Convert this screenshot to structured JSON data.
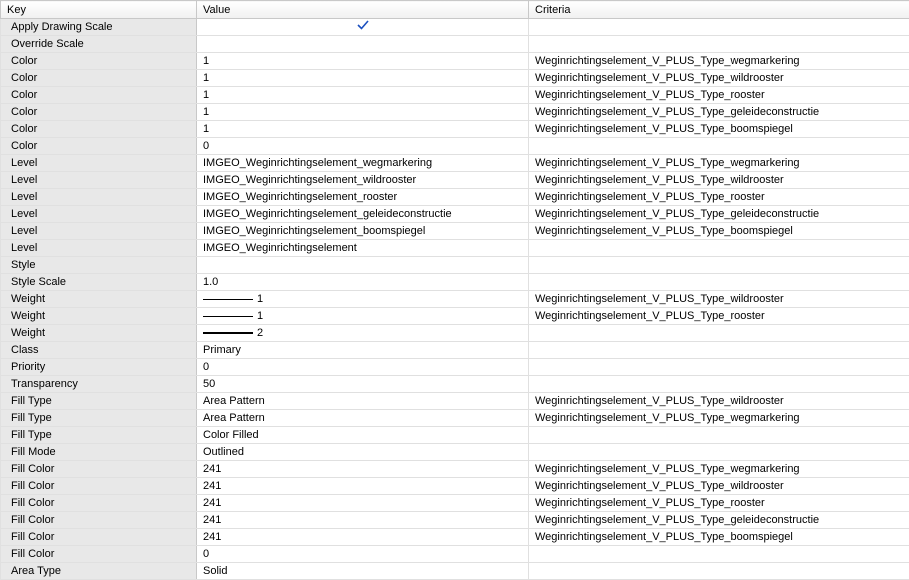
{
  "columns": {
    "key": "Key",
    "value": "Value",
    "criteria": "Criteria"
  },
  "rows": [
    {
      "key": "Apply Drawing Scale",
      "valueType": "check",
      "value": "",
      "criteria": ""
    },
    {
      "key": "Override Scale",
      "value": "",
      "criteria": ""
    },
    {
      "key": "Color",
      "value": "1",
      "criteria": "Weginrichtingselement_V_PLUS_Type_wegmarkering"
    },
    {
      "key": "Color",
      "value": "1",
      "criteria": "Weginrichtingselement_V_PLUS_Type_wildrooster"
    },
    {
      "key": "Color",
      "value": "1",
      "criteria": "Weginrichtingselement_V_PLUS_Type_rooster"
    },
    {
      "key": "Color",
      "value": "1",
      "criteria": "Weginrichtingselement_V_PLUS_Type_geleideconstructie"
    },
    {
      "key": "Color",
      "value": "1",
      "criteria": "Weginrichtingselement_V_PLUS_Type_boomspiegel"
    },
    {
      "key": "Color",
      "value": "0",
      "criteria": ""
    },
    {
      "key": "Level",
      "value": "IMGEO_Weginrichtingselement_wegmarkering",
      "criteria": "Weginrichtingselement_V_PLUS_Type_wegmarkering"
    },
    {
      "key": "Level",
      "value": "IMGEO_Weginrichtingselement_wildrooster",
      "criteria": "Weginrichtingselement_V_PLUS_Type_wildrooster"
    },
    {
      "key": "Level",
      "value": "IMGEO_Weginrichtingselement_rooster",
      "criteria": "Weginrichtingselement_V_PLUS_Type_rooster"
    },
    {
      "key": "Level",
      "value": "IMGEO_Weginrichtingselement_geleideconstructie",
      "criteria": "Weginrichtingselement_V_PLUS_Type_geleideconstructie"
    },
    {
      "key": "Level",
      "value": "IMGEO_Weginrichtingselement_boomspiegel",
      "criteria": "Weginrichtingselement_V_PLUS_Type_boomspiegel"
    },
    {
      "key": "Level",
      "value": "IMGEO_Weginrichtingselement",
      "criteria": ""
    },
    {
      "key": "Style",
      "value": "",
      "criteria": ""
    },
    {
      "key": "Style Scale",
      "value": "1.0",
      "criteria": ""
    },
    {
      "key": "Weight",
      "valueType": "weight",
      "weight": "1",
      "value": "1",
      "criteria": "Weginrichtingselement_V_PLUS_Type_wildrooster"
    },
    {
      "key": "Weight",
      "valueType": "weight",
      "weight": "1",
      "value": "1",
      "criteria": "Weginrichtingselement_V_PLUS_Type_rooster"
    },
    {
      "key": "Weight",
      "valueType": "weight",
      "weight": "2",
      "value": "2",
      "criteria": ""
    },
    {
      "key": "Class",
      "value": "Primary",
      "criteria": ""
    },
    {
      "key": "Priority",
      "value": "0",
      "criteria": ""
    },
    {
      "key": "Transparency",
      "value": "50",
      "criteria": ""
    },
    {
      "key": "Fill Type",
      "value": "Area Pattern",
      "criteria": "Weginrichtingselement_V_PLUS_Type_wildrooster"
    },
    {
      "key": "Fill Type",
      "value": "Area Pattern",
      "criteria": "Weginrichtingselement_V_PLUS_Type_wegmarkering"
    },
    {
      "key": "Fill Type",
      "value": "Color Filled",
      "criteria": ""
    },
    {
      "key": "Fill Mode",
      "value": "Outlined",
      "criteria": ""
    },
    {
      "key": "Fill Color",
      "value": "241",
      "criteria": "Weginrichtingselement_V_PLUS_Type_wegmarkering"
    },
    {
      "key": "Fill Color",
      "value": "241",
      "criteria": "Weginrichtingselement_V_PLUS_Type_wildrooster"
    },
    {
      "key": "Fill Color",
      "value": "241",
      "criteria": "Weginrichtingselement_V_PLUS_Type_rooster"
    },
    {
      "key": "Fill Color",
      "value": "241",
      "criteria": "Weginrichtingselement_V_PLUS_Type_geleideconstructie"
    },
    {
      "key": "Fill Color",
      "value": "241",
      "criteria": "Weginrichtingselement_V_PLUS_Type_boomspiegel"
    },
    {
      "key": "Fill Color",
      "value": "0",
      "criteria": ""
    },
    {
      "key": "Area Type",
      "value": "Solid",
      "criteria": ""
    }
  ]
}
